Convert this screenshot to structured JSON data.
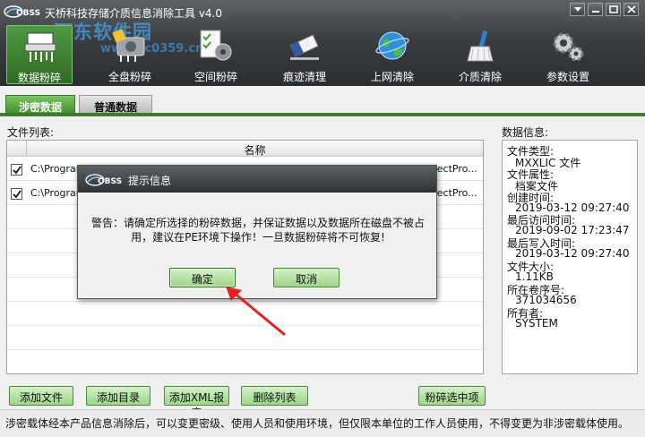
{
  "window": {
    "title": "天桥科技存储介质信息消除工具 v4.0",
    "logo_text": "OBSS"
  },
  "watermark": {
    "text": "河东软件园",
    "url": "www.pc0359.cn"
  },
  "toolbar": {
    "items": [
      {
        "label": "数据粉碎",
        "icon": "shredder-icon",
        "active": true
      },
      {
        "label": "全盘粉碎",
        "icon": "disk-shred-icon",
        "active": false
      },
      {
        "label": "空间粉碎",
        "icon": "checklist-gear-icon",
        "active": false
      },
      {
        "label": "痕迹清理",
        "icon": "eraser-icon",
        "active": false
      },
      {
        "label": "上网清除",
        "icon": "globe-icon",
        "active": false
      },
      {
        "label": "介质清除",
        "icon": "broom-icon",
        "active": false
      },
      {
        "label": "参数设置",
        "icon": "gear-icon",
        "active": false
      }
    ]
  },
  "tabs": [
    {
      "label": "涉密数据",
      "active": true
    },
    {
      "label": "普通数据",
      "active": false
    }
  ],
  "file_list": {
    "label": "文件列表:",
    "column_name": "名称",
    "rows": [
      {
        "checked": true,
        "path_start": "C:\\Program",
        "path_end": "ojectPro..."
      },
      {
        "checked": true,
        "path_start": "C:\\Program",
        "path_end": "ojectPro..."
      }
    ]
  },
  "data_info": {
    "label": "数据信息:",
    "lines": [
      {
        "text": "文件类型:",
        "indent": false
      },
      {
        "text": "MXXLIC 文件",
        "indent": true
      },
      {
        "text": "文件属性:",
        "indent": false
      },
      {
        "text": "档案文件",
        "indent": true
      },
      {
        "text": "创建时间:",
        "indent": false
      },
      {
        "text": "2019-03-12 09:27:40",
        "indent": true
      },
      {
        "text": "最后访问时间:",
        "indent": false
      },
      {
        "text": "2019-09-02 17:23:47",
        "indent": true
      },
      {
        "text": "最后写入时间:",
        "indent": false
      },
      {
        "text": "2019-03-12 09:27:40",
        "indent": true
      },
      {
        "text": "文件大小:",
        "indent": false
      },
      {
        "text": "1.11KB",
        "indent": true
      },
      {
        "text": "所在卷序号:",
        "indent": false
      },
      {
        "text": "371034656",
        "indent": true
      },
      {
        "text": "所有者:",
        "indent": false
      },
      {
        "text": "SYSTEM",
        "indent": true
      }
    ]
  },
  "buttons": {
    "add_file": "添加文件",
    "add_dir": "添加目录",
    "add_xml": "添加XML报表",
    "delete_list": "删除列表",
    "shred_selected": "粉碎选中项"
  },
  "status_bar": {
    "text": "涉密载体经本产品信息消除后，可以变更密级、使用人员和使用环境，但仅限本单位的工作人员使用，不得变更为非涉密载体使用。"
  },
  "dialog": {
    "title": "提示信息",
    "logo_text": "OBSS",
    "message_line1": "警告：请确定所选择的粉碎数据，并保证数据以及数据所在磁盘不被占",
    "message_line2": "用，建议在PE环境下操作！一旦数据粉碎将不可恢复!",
    "ok": "确定",
    "cancel": "取消"
  },
  "colors": {
    "header_dark": "#2b2e30",
    "accent_green": "#3f7a30",
    "button_green": "#9fd489",
    "arrow_red": "#e0231f"
  }
}
